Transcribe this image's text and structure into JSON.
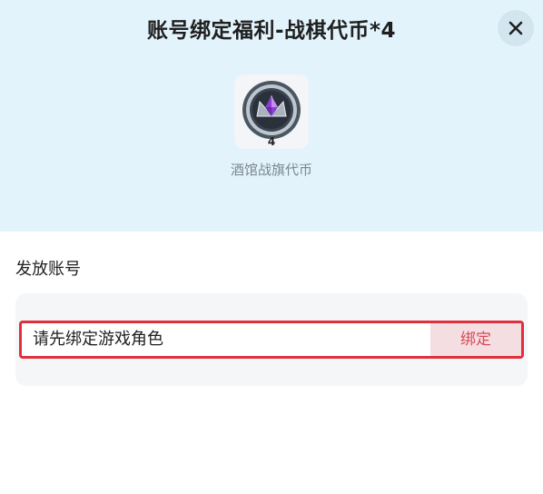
{
  "dialog": {
    "title": "账号绑定福利-战棋代币*4"
  },
  "reward": {
    "icon": "crown-gem-coin-icon",
    "count": "4",
    "name": "酒馆战旗代币"
  },
  "account_section": {
    "label": "发放账号",
    "prompt": "请先绑定游戏角色",
    "bind_button_label": "绑定"
  },
  "colors": {
    "header_background": "#e2f3fb",
    "highlight_border": "#e0303d",
    "bind_button_background": "#f5dee1",
    "bind_button_text": "#d84a59"
  }
}
